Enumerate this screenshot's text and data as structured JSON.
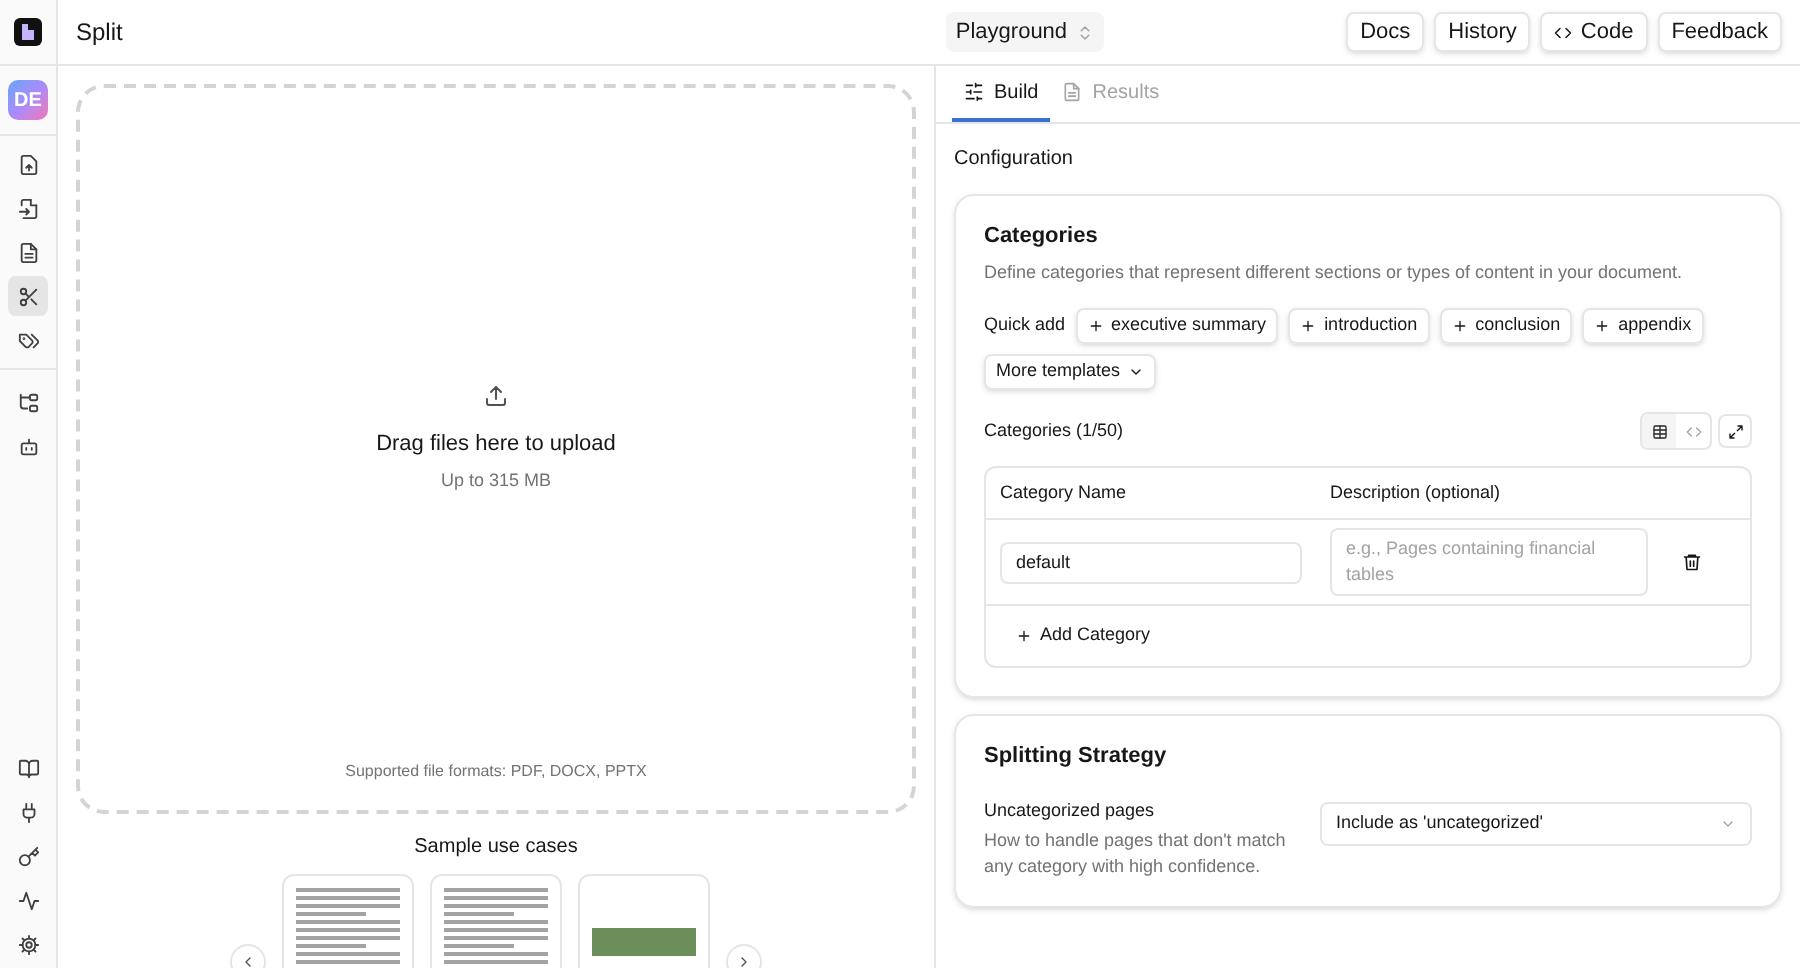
{
  "app": {
    "avatar": "DE",
    "page_title": "Split"
  },
  "nav": {
    "top": [
      {
        "selected": false
      },
      {
        "selected": false
      },
      {
        "selected": false
      },
      {
        "selected": true
      },
      {
        "selected": false
      }
    ],
    "middle": [
      {
        "selected": false
      },
      {
        "selected": false
      }
    ],
    "bottom": [
      {
        "selected": false
      },
      {
        "selected": false
      },
      {
        "selected": false
      },
      {
        "selected": false
      },
      {
        "selected": false
      }
    ]
  },
  "mode_selector": {
    "value": "Playground"
  },
  "header_buttons": [
    "Docs",
    "History",
    "Code",
    "Feedback"
  ],
  "upload": {
    "title": "Drag files here to upload",
    "limit": "Up to 315 MB",
    "formats": "Supported file formats: PDF, DOCX, PPTX"
  },
  "samples": {
    "title": "Sample use cases"
  },
  "tabs": [
    {
      "label": "Build",
      "selected": true
    },
    {
      "label": "Results",
      "selected": false
    }
  ],
  "section_label": "Configuration",
  "categories": {
    "title": "Categories",
    "description": "Define categories that represent different sections or types of content in your document.",
    "quick_add_label": "Quick add",
    "quick_add": [
      "executive summary",
      "introduction",
      "conclusion",
      "appendix"
    ],
    "more_templates": "More templates",
    "count": "Categories (1/50)",
    "view_toggle": [
      {
        "selected": true
      },
      {
        "selected": false
      }
    ],
    "columns": [
      "Category Name",
      "Description (optional)"
    ],
    "rows": [
      {
        "name": "default",
        "description_placeholder": "e.g., Pages containing financial tables"
      }
    ],
    "add_button": "Add Category"
  },
  "splitting": {
    "title": "Splitting Strategy",
    "setting_label": "Uncategorized pages",
    "setting_help": "How to handle pages that don't match any category with high confidence.",
    "value": "Include as 'uncategorized'"
  }
}
